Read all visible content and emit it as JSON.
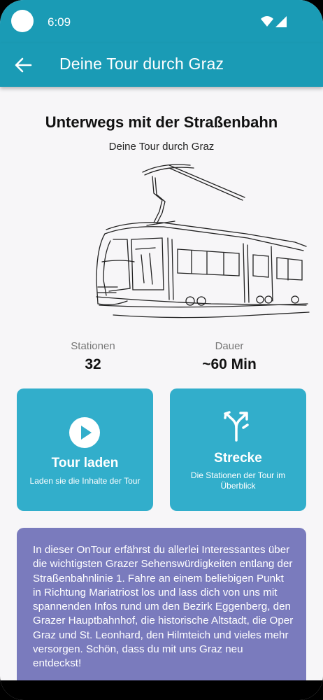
{
  "status_bar": {
    "time": "6:09",
    "icons": [
      "camera-dot-icon",
      "wifi-icon",
      "signal-icon"
    ]
  },
  "app_bar": {
    "back_icon": "arrow-back-icon",
    "title": "Deine Tour durch Graz"
  },
  "main": {
    "heading": "Unterwegs mit der Straßenbahn",
    "subheading": "Deine Tour durch Graz",
    "illustration": "tram-sketch",
    "stats": [
      {
        "label": "Stationen",
        "value": "32"
      },
      {
        "label": "Dauer",
        "value": "~60 Min"
      }
    ],
    "cards": [
      {
        "icon": "play-circle-icon",
        "title": "Tour laden",
        "description": "Laden sie die Inhalte der Tour"
      },
      {
        "icon": "fork-route-icon",
        "title": "Strecke",
        "description": "Die Stationen der Tour im Überblick"
      }
    ],
    "info_text": "In dieser OnTour erfährst du allerlei Interessantes über die wichtigsten Grazer Sehenswürdigkeiten entlang der Straßenbahnlinie 1. Fahre an einem beliebigen Punkt in Richtung Mariatriost los und lass dich von uns mit spannenden Infos rund um den Bezirk Eggenberg, den Grazer Hauptbahnhof, die historische Altstadt, die Oper Graz und St. Leonhard, den Hilmteich und vieles mehr versorgen. Schön, dass du mit uns Graz neu entdeckst!"
  },
  "colors": {
    "primary": "#1a9bb5",
    "card": "#32aecb",
    "info_card": "#7a7bbd",
    "background": "#f7f6f8"
  }
}
